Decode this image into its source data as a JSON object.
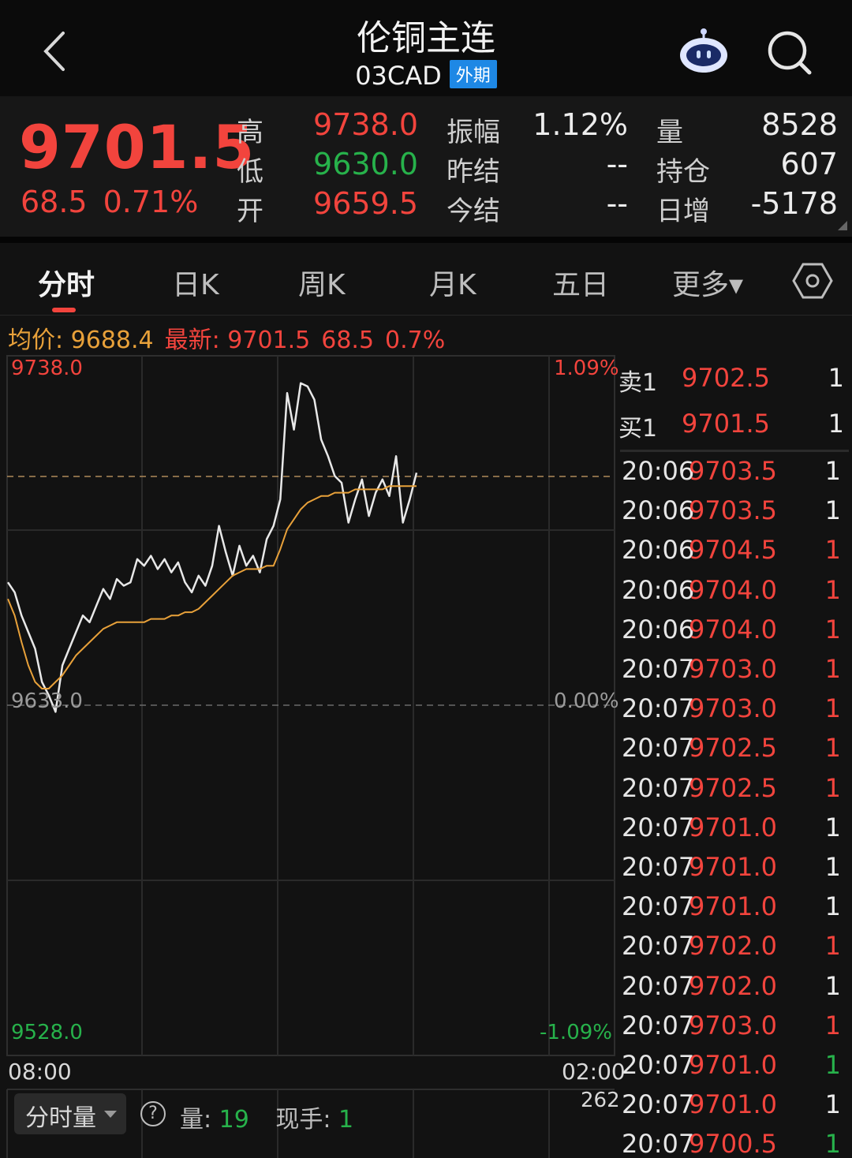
{
  "header": {
    "title": "伦铜主连",
    "code": "03CAD",
    "tag": "外期"
  },
  "quote": {
    "last": "9701.5",
    "change": "68.5",
    "change_pct": "0.71%",
    "stats": [
      {
        "label": "高",
        "value": "9738.0",
        "color": "#f2443d"
      },
      {
        "label": "低",
        "value": "9630.0",
        "color": "#27b24b"
      },
      {
        "label": "开",
        "value": "9659.5",
        "color": "#f2443d"
      },
      {
        "label": "振幅",
        "value": "1.12%",
        "color": "#ececec"
      },
      {
        "label": "昨结",
        "value": "--",
        "color": "#ececec"
      },
      {
        "label": "今结",
        "value": "--",
        "color": "#ececec"
      },
      {
        "label": "量",
        "value": "8528",
        "color": "#ececec"
      },
      {
        "label": "持仓",
        "value": "607",
        "color": "#ececec"
      },
      {
        "label": "日增",
        "value": "-5178",
        "color": "#ececec"
      }
    ]
  },
  "tabs": [
    "分时",
    "日K",
    "周K",
    "月K",
    "五日",
    "更多▾"
  ],
  "legend": {
    "avg_label": "均价: 9688.4",
    "latest_label": "最新: 9701.5",
    "latest_change": "68.5",
    "latest_pct": "0.7%"
  },
  "chart_data": {
    "type": "line",
    "y_top_label": "9738.0",
    "y_mid_label": "9633.0",
    "y_bottom_label": "9528.0",
    "pct_top_label": "1.09%",
    "pct_mid_label": "0.00%",
    "pct_bottom_label": "-1.09%",
    "x_start_label": "08:00",
    "x_end_label": "02:00",
    "ylim": [
      9528.0,
      9738.0
    ],
    "reference": 9633.0,
    "series": [
      {
        "color": "#e8e8e8",
        "values": [
          9670,
          9667,
          9660,
          9655,
          9650,
          9640,
          9636,
          9631,
          9645,
          9650,
          9655,
          9660,
          9658,
          9663,
          9668,
          9665,
          9671,
          9669,
          9670,
          9677,
          9675,
          9678,
          9674,
          9677,
          9673,
          9676,
          9670,
          9667,
          9672,
          9669,
          9675,
          9687,
          9679,
          9672,
          9681,
          9675,
          9678,
          9673,
          9683,
          9687,
          9695,
          9727,
          9716,
          9730,
          9729,
          9725,
          9713,
          9708,
          9702,
          9700,
          9688,
          9695,
          9701,
          9690,
          9697,
          9701,
          9696,
          9708,
          9688,
          9695,
          9703
        ]
      },
      {
        "color": "#e8a13a",
        "values": [
          9665,
          9660,
          9652,
          9645,
          9640,
          9638,
          9638,
          9640,
          9642,
          9645,
          9648,
          9650,
          9652,
          9654,
          9656,
          9657,
          9658,
          9658,
          9658,
          9658,
          9658,
          9659,
          9659,
          9659,
          9660,
          9660,
          9661,
          9661,
          9662,
          9664,
          9666,
          9668,
          9670,
          9672,
          9673,
          9674,
          9674,
          9674,
          9675,
          9675,
          9680,
          9686,
          9689,
          9692,
          9694,
          9695,
          9696,
          9696,
          9697,
          9697,
          9697,
          9698,
          9698,
          9698,
          9698,
          9698,
          9699,
          9699,
          9699,
          9699,
          9699
        ]
      }
    ]
  },
  "volume": {
    "selector": "分时量",
    "help": "?",
    "qty_label": "量: ",
    "qty_value": "19",
    "hand_label": "现手: ",
    "hand_value": "1",
    "max_label": "262"
  },
  "order_book": {
    "sell": {
      "label": "卖1",
      "price": "9702.5",
      "qty": "1"
    },
    "buy": {
      "label": "买1",
      "price": "9701.5",
      "qty": "1"
    }
  },
  "ticks": [
    {
      "time": "20:06",
      "price": "9703.5",
      "vol": "1",
      "dir": "white"
    },
    {
      "time": "20:06",
      "price": "9703.5",
      "vol": "1",
      "dir": "white"
    },
    {
      "time": "20:06",
      "price": "9704.5",
      "vol": "1",
      "dir": "red"
    },
    {
      "time": "20:06",
      "price": "9704.0",
      "vol": "1",
      "dir": "red"
    },
    {
      "time": "20:06",
      "price": "9704.0",
      "vol": "1",
      "dir": "red"
    },
    {
      "time": "20:07",
      "price": "9703.0",
      "vol": "1",
      "dir": "red"
    },
    {
      "time": "20:07",
      "price": "9703.0",
      "vol": "1",
      "dir": "red"
    },
    {
      "time": "20:07",
      "price": "9702.5",
      "vol": "1",
      "dir": "red"
    },
    {
      "time": "20:07",
      "price": "9702.5",
      "vol": "1",
      "dir": "red"
    },
    {
      "time": "20:07",
      "price": "9701.0",
      "vol": "1",
      "dir": "white"
    },
    {
      "time": "20:07",
      "price": "9701.0",
      "vol": "1",
      "dir": "white"
    },
    {
      "time": "20:07",
      "price": "9701.0",
      "vol": "1",
      "dir": "white"
    },
    {
      "time": "20:07",
      "price": "9702.0",
      "vol": "1",
      "dir": "red"
    },
    {
      "time": "20:07",
      "price": "9702.0",
      "vol": "1",
      "dir": "white"
    },
    {
      "time": "20:07",
      "price": "9703.0",
      "vol": "1",
      "dir": "red"
    },
    {
      "time": "20:07",
      "price": "9701.0",
      "vol": "1",
      "dir": "green"
    },
    {
      "time": "20:07",
      "price": "9701.0",
      "vol": "1",
      "dir": "white"
    },
    {
      "time": "20:07",
      "price": "9700.5",
      "vol": "1",
      "dir": "green"
    }
  ],
  "colors": {
    "red": "#f2443d",
    "green": "#27b24b",
    "avg": "#e8a13a",
    "price_line": "#e8e8e8"
  }
}
